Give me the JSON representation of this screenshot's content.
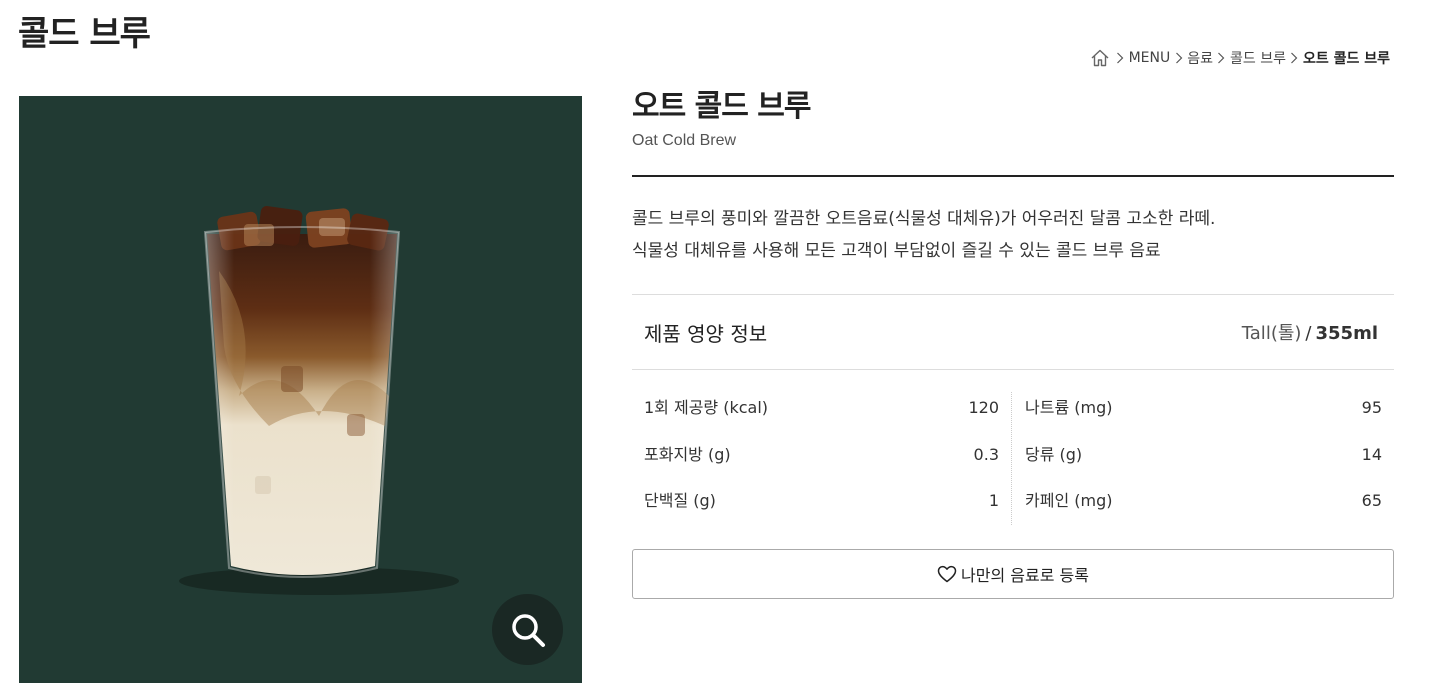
{
  "page": {
    "title": "콜드 브루"
  },
  "breadcrumb": {
    "items": [
      "MENU",
      "음료",
      "콜드 브루"
    ],
    "current": "오트 콜드 브루"
  },
  "product": {
    "name": "오트 콜드 브루",
    "name_en": "Oat Cold Brew",
    "description": [
      "콜드 브루의 풍미와 깔끔한 오트음료(식물성 대체유)가 어우러진 달콤 고소한 라떼.",
      "식물성 대체유를 사용해 모든 고객이 부담없이 즐길 수 있는 콜드 브루 음료"
    ],
    "image_bg_color": "#213a33"
  },
  "nutrition": {
    "title": "제품 영양 정보",
    "size_label": "Tall(톨)",
    "separator": "/",
    "volume": "355ml",
    "left": [
      {
        "label": "1회 제공량 (kcal)",
        "value": "120"
      },
      {
        "label": "포화지방 (g)",
        "value": "0.3"
      },
      {
        "label": "단백질 (g)",
        "value": "1"
      }
    ],
    "right": [
      {
        "label": "나트륨 (mg)",
        "value": "95"
      },
      {
        "label": "당류 (g)",
        "value": "14"
      },
      {
        "label": "카페인 (mg)",
        "value": "65"
      }
    ]
  },
  "favorite": {
    "label": "나만의 음료로 등록",
    "icon": "heart-icon"
  },
  "icons": {
    "home": "home-icon",
    "zoom": "search-icon",
    "separator": "chevron-right-icon"
  }
}
